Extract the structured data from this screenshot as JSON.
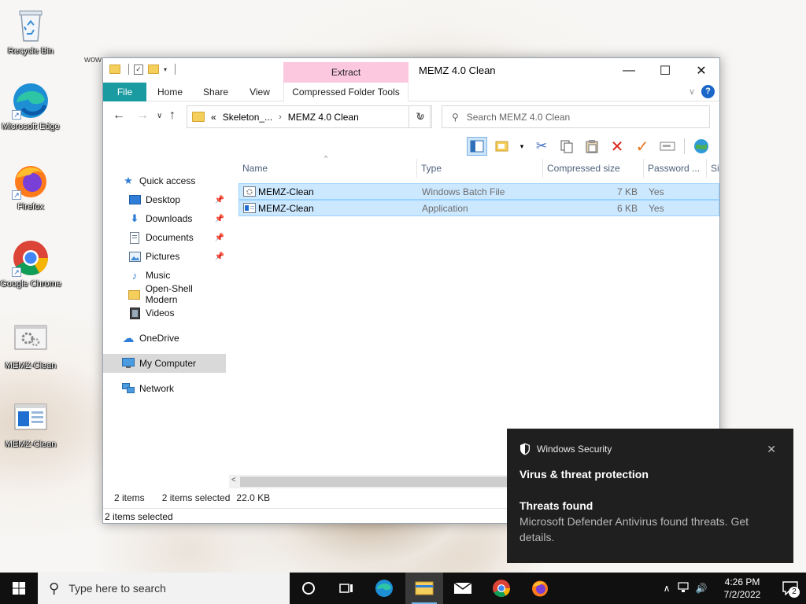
{
  "desktop": {
    "fragment_text": "wow",
    "icons": [
      {
        "label": "Recycle Bin"
      },
      {
        "label": "Microsoft Edge"
      },
      {
        "label": "Firefox"
      },
      {
        "label": "Google Chrome"
      },
      {
        "label": "MEMZ-Clean"
      },
      {
        "label": "MEMZ-Clean"
      }
    ]
  },
  "window": {
    "title": "MEMZ 4.0 Clean",
    "contextual_tab_header": "Extract",
    "tabs": [
      "File",
      "Home",
      "Share",
      "View",
      "Compressed Folder Tools"
    ],
    "address": {
      "overflow": "«",
      "crumbs": [
        "Skeleton_...",
        "MEMZ 4.0 Clean"
      ]
    },
    "search_placeholder": "Search MEMZ 4.0 Clean"
  },
  "nav": {
    "quick_access": "Quick access",
    "items": [
      {
        "label": "Desktop",
        "icon": "desktop-icon",
        "pinned": true
      },
      {
        "label": "Downloads",
        "icon": "downloads-icon",
        "pinned": true
      },
      {
        "label": "Documents",
        "icon": "documents-icon",
        "pinned": true
      },
      {
        "label": "Pictures",
        "icon": "pictures-icon",
        "pinned": true
      },
      {
        "label": "Music",
        "icon": "music-icon",
        "pinned": false
      },
      {
        "label": "Open-Shell Modern",
        "icon": "folder-icon",
        "pinned": false
      },
      {
        "label": "Videos",
        "icon": "videos-icon",
        "pinned": false
      }
    ],
    "onedrive": "OneDrive",
    "my_computer": "My Computer",
    "network": "Network"
  },
  "columns": [
    "Name",
    "Type",
    "Compressed size",
    "Password ...",
    "Si"
  ],
  "files": [
    {
      "name": "MEMZ-Clean",
      "type": "Windows Batch File",
      "size": "7 KB",
      "password": "Yes"
    },
    {
      "name": "MEMZ-Clean",
      "type": "Application",
      "size": "6 KB",
      "password": "Yes"
    }
  ],
  "info": {
    "count": "2 items",
    "selected": "2 items selected",
    "size": "22.0 KB"
  },
  "status": "2 items selected",
  "toast": {
    "app": "Windows Security",
    "title": "Virus & threat protection",
    "subtitle": "Threats found",
    "message": "Microsoft Defender Antivirus found threats. Get details."
  },
  "taskbar": {
    "search_placeholder": "Type here to search",
    "time": "4:26 PM",
    "date": "7/2/2022",
    "notification_count": "2"
  },
  "colors": {
    "accent": "#1a9ba1",
    "selection": "#cce8ff",
    "extract_tab": "#fbc8e0",
    "toast_bg": "#1f1f1f"
  }
}
